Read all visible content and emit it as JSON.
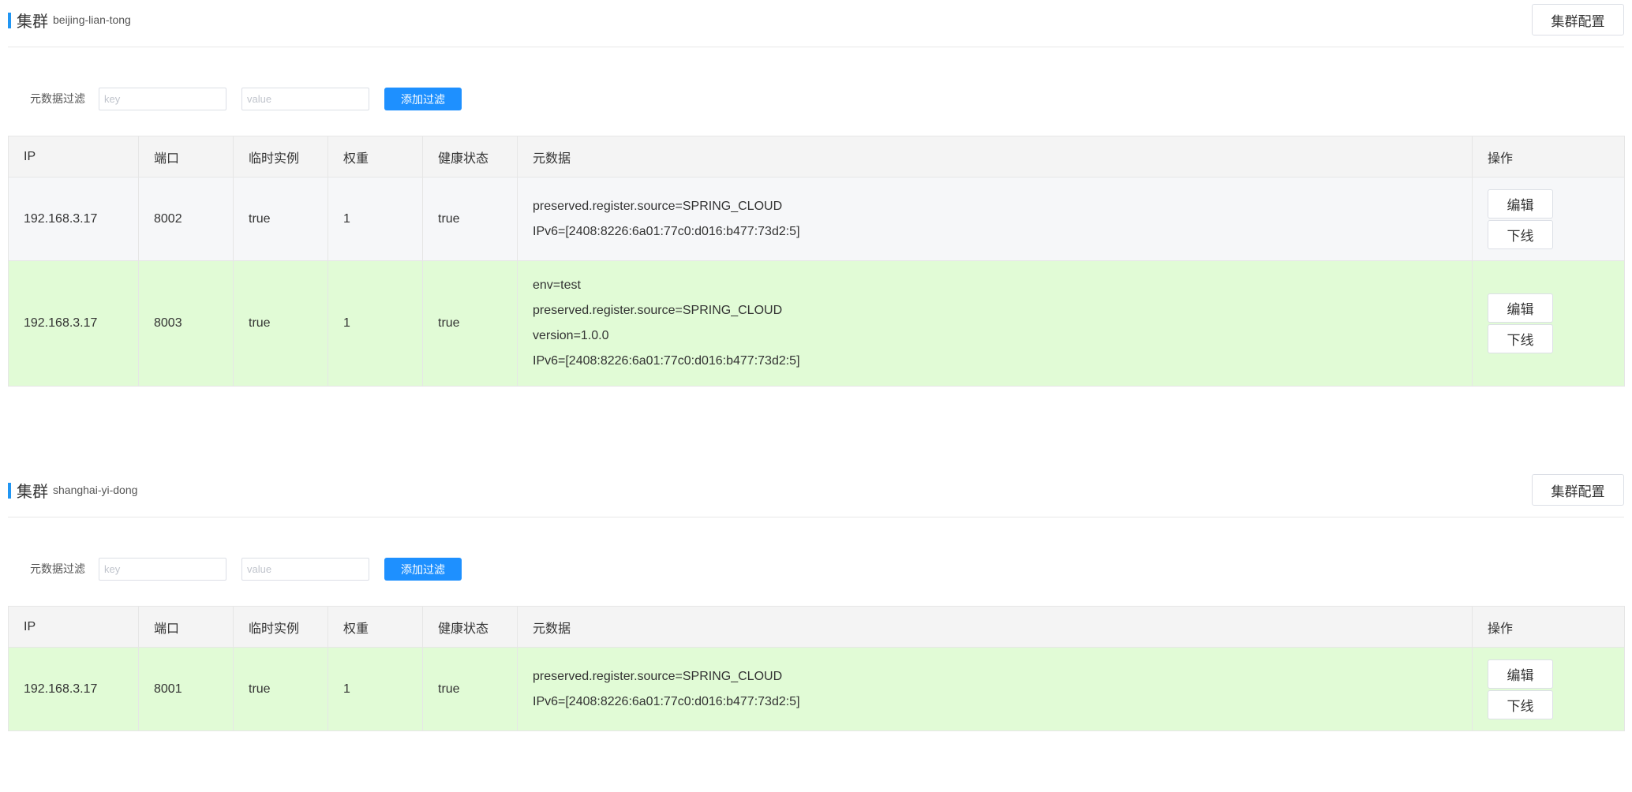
{
  "clusters": [
    {
      "title": "集群",
      "name": "beijing-lian-tong",
      "config_label": "集群配置",
      "filter": {
        "label": "元数据过滤",
        "key_placeholder": "key",
        "value_placeholder": "value",
        "add_label": "添加过滤"
      },
      "columns": [
        "IP",
        "端口",
        "临时实例",
        "权重",
        "健康状态",
        "元数据",
        "操作"
      ],
      "rows": [
        {
          "ip": "192.168.3.17",
          "port": "8002",
          "ephemeral": "true",
          "weight": "1",
          "healthy": "true",
          "metadata": [
            "preserved.register.source=SPRING_CLOUD",
            "IPv6=[2408:8226:6a01:77c0:d016:b477:73d2:5]"
          ],
          "highlight": false,
          "edit_label": "编辑",
          "offline_label": "下线"
        },
        {
          "ip": "192.168.3.17",
          "port": "8003",
          "ephemeral": "true",
          "weight": "1",
          "healthy": "true",
          "metadata": [
            "env=test",
            "preserved.register.source=SPRING_CLOUD",
            "version=1.0.0",
            "IPv6=[2408:8226:6a01:77c0:d016:b477:73d2:5]"
          ],
          "highlight": true,
          "edit_label": "编辑",
          "offline_label": "下线"
        }
      ]
    },
    {
      "title": "集群",
      "name": "shanghai-yi-dong",
      "config_label": "集群配置",
      "filter": {
        "label": "元数据过滤",
        "key_placeholder": "key",
        "value_placeholder": "value",
        "add_label": "添加过滤"
      },
      "columns": [
        "IP",
        "端口",
        "临时实例",
        "权重",
        "健康状态",
        "元数据",
        "操作"
      ],
      "rows": [
        {
          "ip": "192.168.3.17",
          "port": "8001",
          "ephemeral": "true",
          "weight": "1",
          "healthy": "true",
          "metadata": [
            "preserved.register.source=SPRING_CLOUD",
            "IPv6=[2408:8226:6a01:77c0:d016:b477:73d2:5]"
          ],
          "highlight": true,
          "edit_label": "编辑",
          "offline_label": "下线"
        }
      ]
    }
  ],
  "colors": {
    "accent": "#2196f3",
    "add_button": "#1e90ff",
    "highlight_row": "#e1fbd6",
    "normal_row": "#f6f7f9",
    "header_row": "#f4f4f4"
  }
}
